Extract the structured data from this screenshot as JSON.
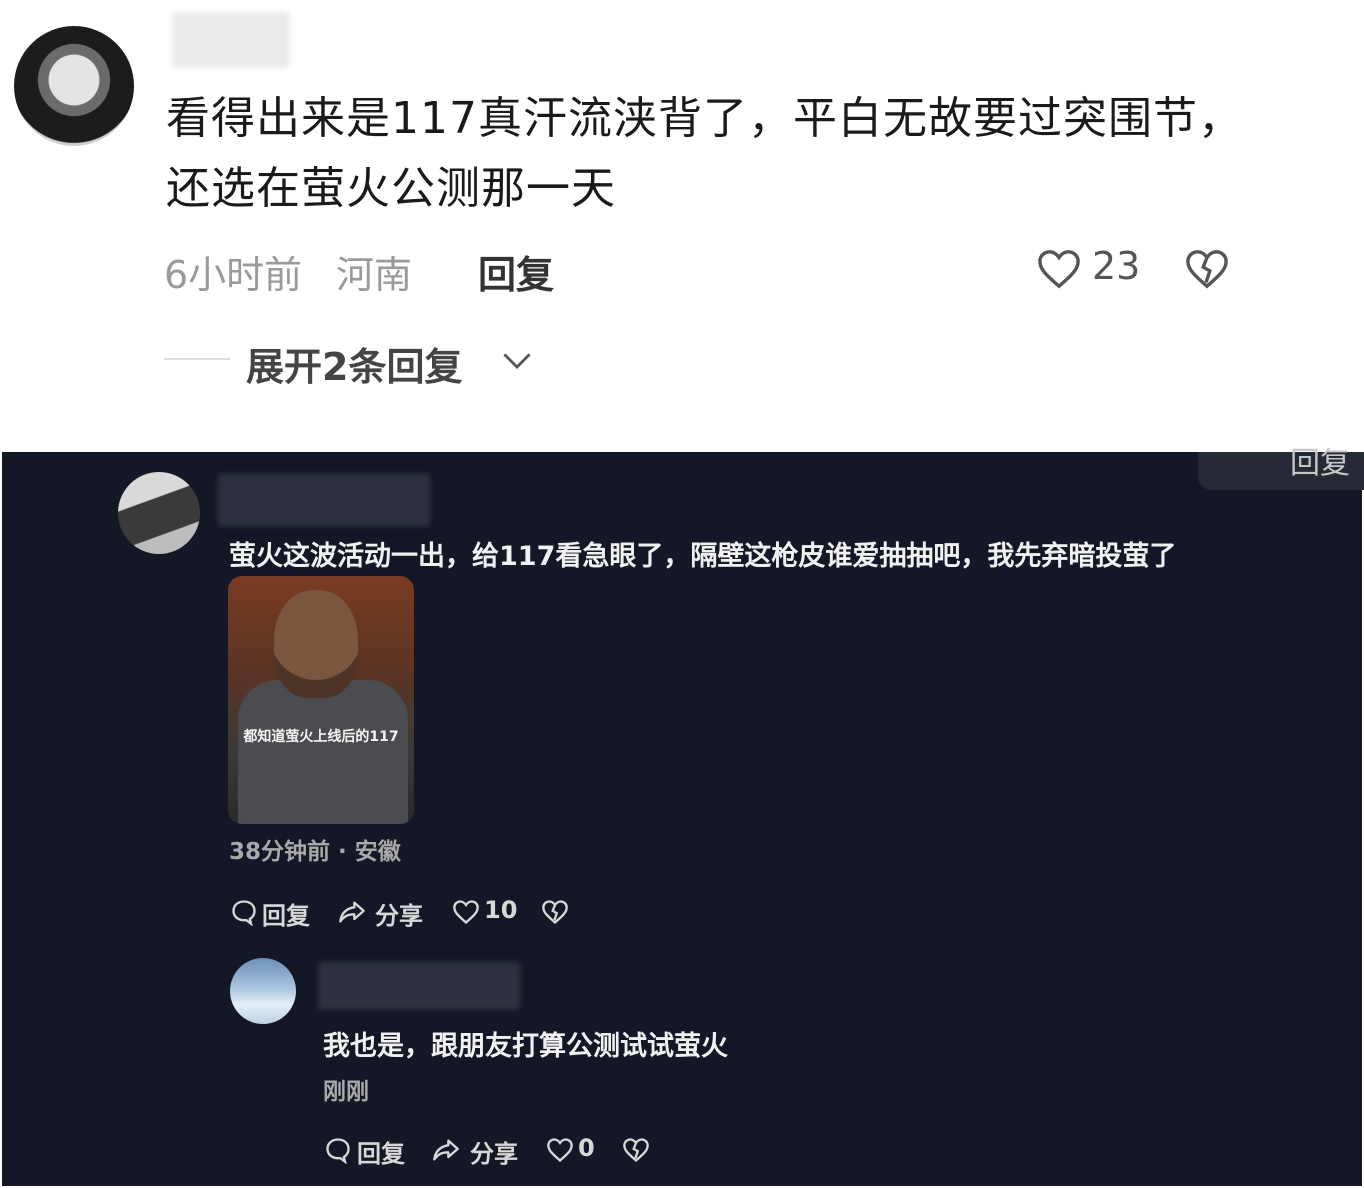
{
  "top_comment": {
    "text": "看得出来是117真汗流浃背了，平白无故要过突围节，还选在萤火公测那一天",
    "time": "6小时前",
    "region": "河南",
    "reply_label": "回复",
    "like_count": "23",
    "expand_label": "展开2条回复",
    "icons": [
      "heart-icon",
      "broken-heart-icon",
      "chevron-down-icon"
    ]
  },
  "corner_button": {
    "label": "回复"
  },
  "comment_1": {
    "text": "萤火这波活动一出，给117看急眼了，隔壁这枪皮谁爱抽抽吧，我先弃暗投萤了",
    "meme_caption": "都知道萤火上线后的117",
    "meta": "38分钟前 · 安徽",
    "actions": {
      "reply": "回复",
      "share": "分享",
      "like_count": "10"
    }
  },
  "comment_2": {
    "text": "我也是，跟朋友打算公测试试萤火",
    "meta": "刚刚",
    "actions": {
      "reply": "回复",
      "share": "分享",
      "like_count": "0"
    }
  },
  "colors": {
    "dark_bg": "#141826",
    "light_bg": "#ffffff"
  }
}
